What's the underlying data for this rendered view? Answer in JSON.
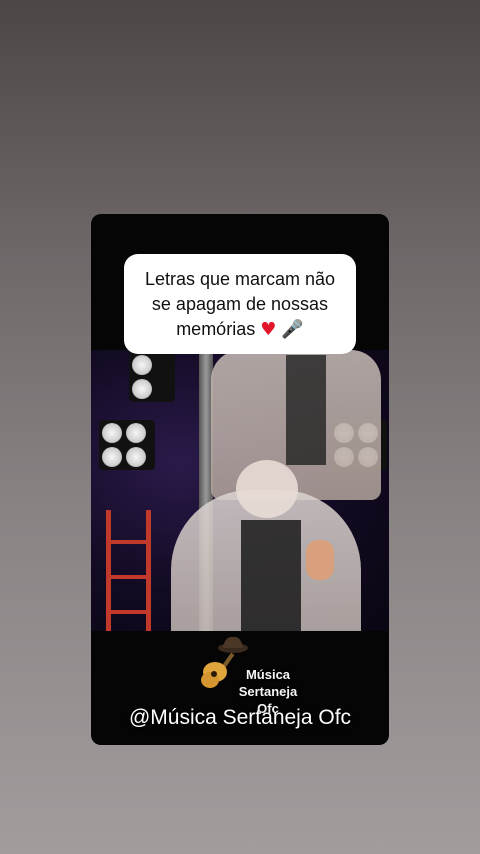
{
  "caption": {
    "line1": "Letras que marcam não",
    "line2": "se apagam de nossas",
    "line3": "memórias",
    "heart_icon": "red-heart-icon",
    "mic_icon": "microphone-icon"
  },
  "watermark": {
    "logo_line1": "Música",
    "logo_line2": "Sertaneja",
    "logo_line3": "Ofc",
    "logo_icon": "guitar-hat-icon"
  },
  "handle": "@Música Sertaneja Ofc",
  "colors": {
    "background_top": "#4d4647",
    "background_bottom": "#a29c9d",
    "card": "#050505",
    "heart": "#e0142b"
  }
}
